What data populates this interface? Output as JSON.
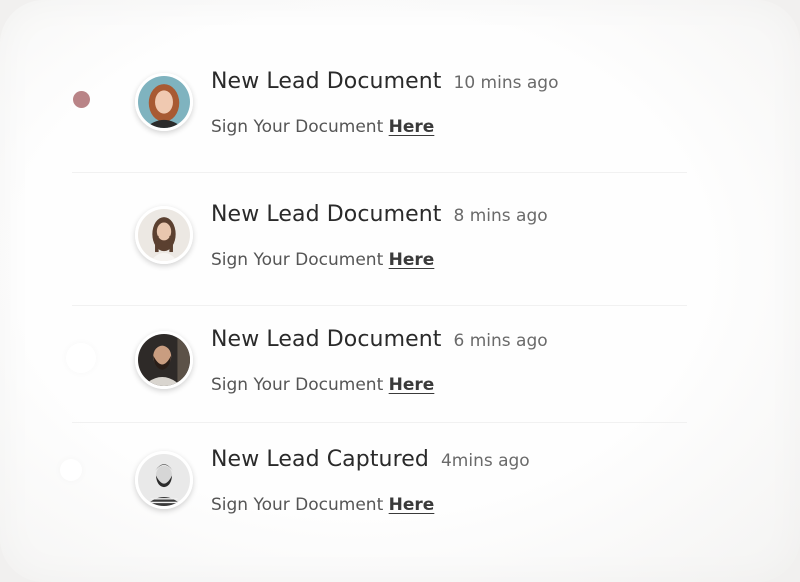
{
  "notifications": [
    {
      "title": "New Lead Document",
      "time": "10 mins ago",
      "subtitle_prefix": "Sign Your Document",
      "link_label": "Here",
      "unread": true,
      "avatar": "woman-redhead-avatar"
    },
    {
      "title": "New Lead Document",
      "time": "8 mins ago",
      "subtitle_prefix": "Sign Your Document",
      "link_label": "Here",
      "unread": false,
      "avatar": "woman-dark-hair-avatar"
    },
    {
      "title": "New Lead Document",
      "time": "6 mins ago",
      "subtitle_prefix": "Sign Your Document",
      "link_label": "Here",
      "unread": false,
      "avatar": "man-beard-avatar"
    },
    {
      "title": "New Lead Captured",
      "time": "4mins ago",
      "subtitle_prefix": "Sign Your Document",
      "link_label": "Here",
      "unread": false,
      "avatar": "man-bw-avatar"
    }
  ],
  "colors": {
    "unread_dot": "#b98487",
    "title": "#2a2a2a",
    "time": "#6a6a6a"
  }
}
